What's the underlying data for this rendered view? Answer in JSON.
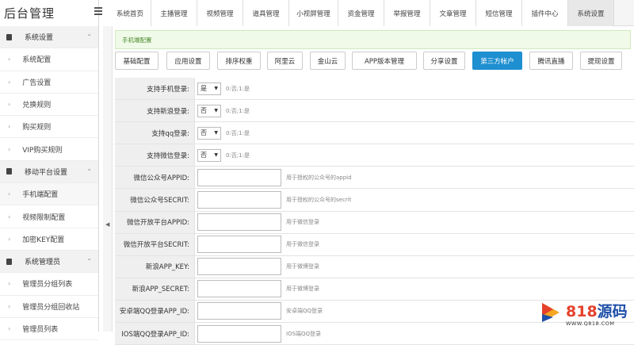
{
  "app": {
    "title": "后台管理"
  },
  "tabs": [
    {
      "label": "系统首页"
    },
    {
      "label": "主播管理"
    },
    {
      "label": "视频管理"
    },
    {
      "label": "道具管理"
    },
    {
      "label": "小视屏管理"
    },
    {
      "label": "资金管理"
    },
    {
      "label": "举报管理"
    },
    {
      "label": "文章管理"
    },
    {
      "label": "短信管理"
    },
    {
      "label": "插件中心"
    },
    {
      "label": "系统设置"
    }
  ],
  "sidebar": {
    "groups": [
      {
        "label": "系统设置",
        "items": [
          {
            "label": "系统配置"
          },
          {
            "label": "广告设置"
          },
          {
            "label": "兑换规则"
          },
          {
            "label": "购买规则"
          },
          {
            "label": "VIP购买规则"
          }
        ]
      },
      {
        "label": "移动平台设置",
        "items": [
          {
            "label": "手机端配置"
          },
          {
            "label": "视频限制配置"
          },
          {
            "label": "加密KEY配置"
          }
        ]
      },
      {
        "label": "系统管理员",
        "items": [
          {
            "label": "管理员分组列表"
          },
          {
            "label": "管理员分组回收站"
          },
          {
            "label": "管理员列表"
          }
        ]
      }
    ]
  },
  "notice": "手机端配置",
  "buttons": [
    {
      "label": "基础配置"
    },
    {
      "label": "应用设置"
    },
    {
      "label": "排序权重"
    },
    {
      "label": "阿里云"
    },
    {
      "label": "金山云"
    },
    {
      "label": "APP版本管理"
    },
    {
      "label": "分享设置"
    },
    {
      "label": "第三方帐户"
    },
    {
      "label": "腾讯直播"
    },
    {
      "label": "提现设置"
    }
  ],
  "form": {
    "selects": [
      {
        "label": "支持手机登录:",
        "value": "是",
        "hint": "0:否;1:是"
      },
      {
        "label": "支持新浪登录:",
        "value": "否",
        "hint": "0:否;1:是"
      },
      {
        "label": "支持qq登录:",
        "value": "否",
        "hint": "0:否;1:是"
      },
      {
        "label": "支持微信登录:",
        "value": "否",
        "hint": "0:否;1:是"
      }
    ],
    "inputs": [
      {
        "label": "微信公众号APPID:",
        "value": "",
        "hint": "用于授权的公众号的appid"
      },
      {
        "label": "微信公众号SECRIT:",
        "value": "",
        "hint": "用于授权的公众号的secrit"
      },
      {
        "label": "微信开放平台APPID:",
        "value": "",
        "hint": "用于微信登录"
      },
      {
        "label": "微信开放平台SECRIT:",
        "value": "",
        "hint": "用于微信登录"
      },
      {
        "label": "新浪APP_KEY:",
        "value": "",
        "hint": "用于微博登录"
      },
      {
        "label": "新浪APP_SECRET:",
        "value": "",
        "hint": "用于微博登录"
      },
      {
        "label": "安卓端QQ登录APP_ID:",
        "value": "",
        "hint": "安卓端QQ登录"
      },
      {
        "label": "IOS端QQ登录APP_ID:",
        "value": "",
        "hint": "IOS端QQ登录"
      }
    ]
  },
  "watermark": {
    "brand_num": "818",
    "brand_cn": "源码",
    "url": "WWW.Q818.COM"
  },
  "colors": {
    "primary": "#1e8fd0",
    "notice_bg": "#f0fae8",
    "watermark_red": "#e5412a",
    "watermark_blue": "#1f4fa8"
  }
}
